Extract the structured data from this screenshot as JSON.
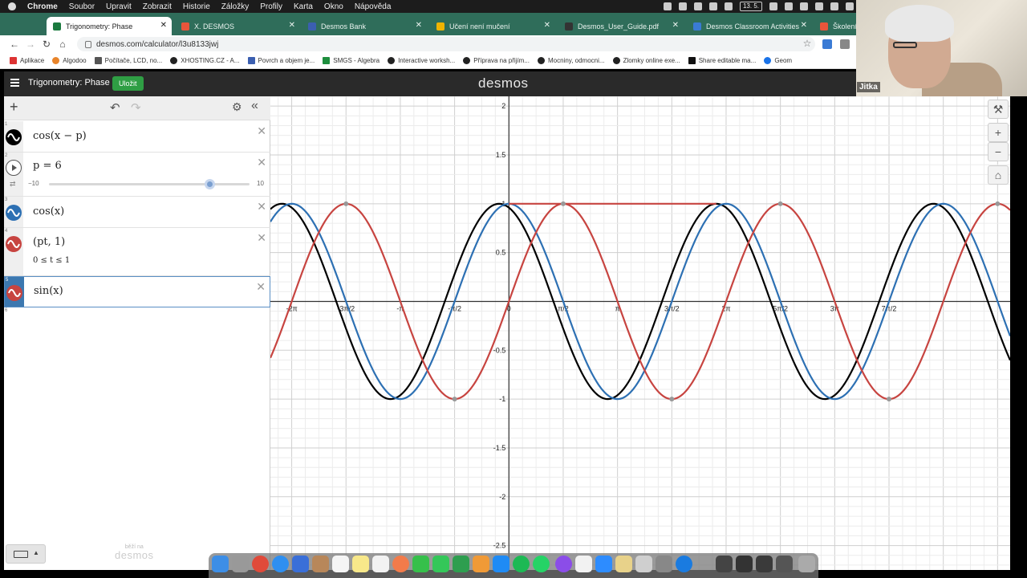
{
  "menubar": {
    "items": [
      "Chrome",
      "Soubor",
      "Upravit",
      "Zobrazit",
      "Historie",
      "Záložky",
      "Profily",
      "Karta",
      "Okno",
      "Nápověda"
    ],
    "date": "13. 5."
  },
  "browser": {
    "tabs": [
      {
        "label": "Trigonometry: Phase",
        "color": "#1b7a3f"
      },
      {
        "label": "X. DESMOS",
        "color": "#e8553b"
      },
      {
        "label": "Desmos Bank",
        "color": "#3b5fb0"
      },
      {
        "label": "Učení není mučení",
        "color": "#f0b400"
      },
      {
        "label": "Desmos_User_Guide.pdf",
        "color": "#333333"
      },
      {
        "label": "Desmos Classroom Activities",
        "color": "#3a7bd5"
      },
      {
        "label": "Školení D",
        "color": "#e8553b"
      }
    ],
    "url": "desmos.com/calculator/l3u8133jwj",
    "bookmarks": [
      "Aplikace",
      "Algodoo",
      "Počítače, LCD, no...",
      "XHOSTING.CZ - A...",
      "Povrch a objem je...",
      "SMGS - Algebra",
      "Interactive worksh...",
      "Příprava na přijím...",
      "Mocniny, odmocni...",
      "Zlomky online exe...",
      "Share editable ma...",
      "Geom"
    ]
  },
  "webcam": {
    "name": "Jitka"
  },
  "desmos": {
    "graph_title": "Trigonometry: Phase",
    "save_label": "Uložit",
    "logo": "desmos",
    "powered_by": "běží na",
    "powered_logo": "desmos",
    "expressions": [
      {
        "num": "1",
        "text": "cos(x − p)",
        "color": "#000000"
      },
      {
        "num": "2",
        "text": "p = 6",
        "slider_min": "−10",
        "slider_max": "10",
        "slider_value": 6
      },
      {
        "num": "3",
        "text": "cos(x)",
        "color": "#2d70b3"
      },
      {
        "num": "4",
        "text": "(pt, 1)",
        "restriction": "0   ≤ t ≤  1",
        "color": "#c74440"
      },
      {
        "num": "5",
        "text": "sin(x)",
        "color": "#c74440"
      },
      {
        "num": "6",
        "text": ""
      }
    ]
  },
  "chart_data": {
    "type": "line",
    "xlim": [
      -6.9,
      14.5
    ],
    "ylim": [
      -2.75,
      2.1
    ],
    "grid": true,
    "x_tick_labels": [
      "-3π",
      "-5π/2",
      "-2π",
      "-3π/2",
      "-π",
      "-π/2",
      "0",
      "π/2",
      "π",
      "3π/2",
      "2π",
      "5π/2",
      "3π",
      "7π/2"
    ],
    "y_tick_labels": [
      "2",
      "1.5",
      "1",
      "0.5",
      "-0.5",
      "-1",
      "-1.5",
      "-2",
      "-2.5"
    ],
    "series": [
      {
        "expression": "cos(x − p)",
        "p": 6,
        "color": "#000000"
      },
      {
        "expression": "cos(x)",
        "color": "#2d70b3"
      },
      {
        "expression": "sin(x)",
        "color": "#c74440"
      },
      {
        "expression": "(pt, 1)",
        "t_range": [
          0,
          1
        ],
        "color": "#c74440"
      }
    ]
  }
}
